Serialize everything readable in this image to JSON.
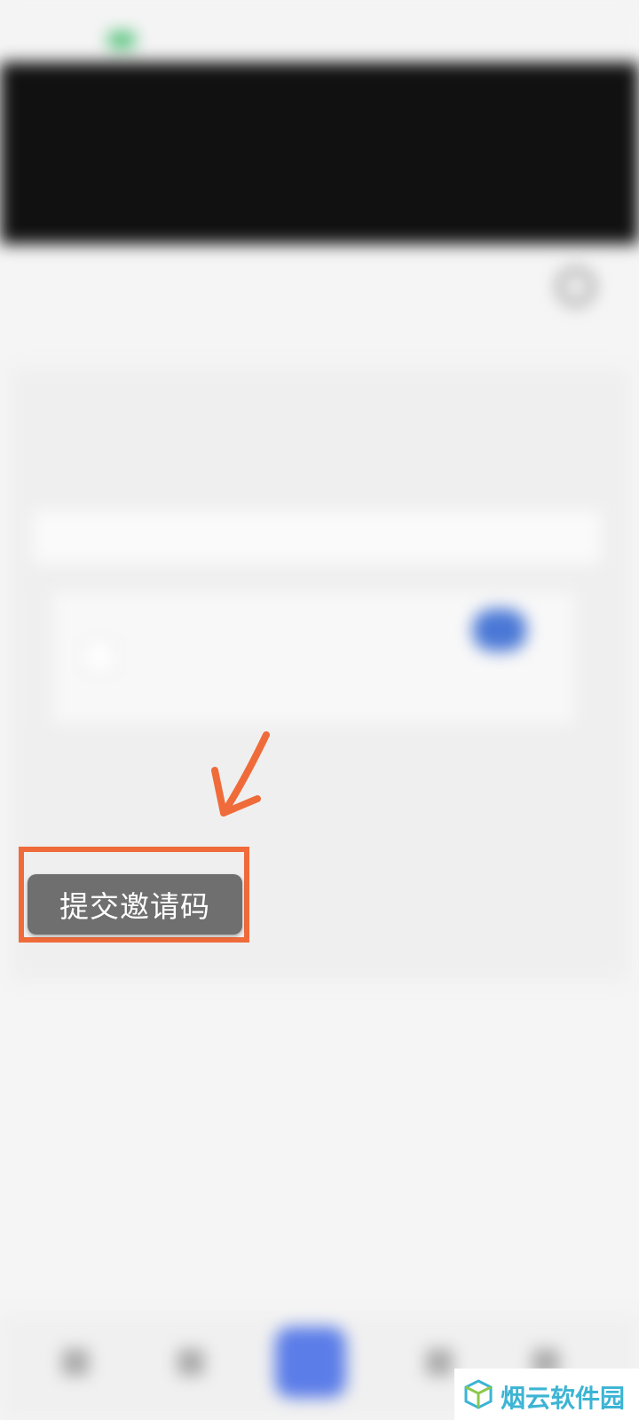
{
  "submit_button": {
    "label": "提交邀请码"
  },
  "watermark": {
    "text": "烟云软件园"
  },
  "colors": {
    "highlight": "#f06b3a",
    "button": "#6f6f6f",
    "watermark": "#3cb4d4"
  }
}
